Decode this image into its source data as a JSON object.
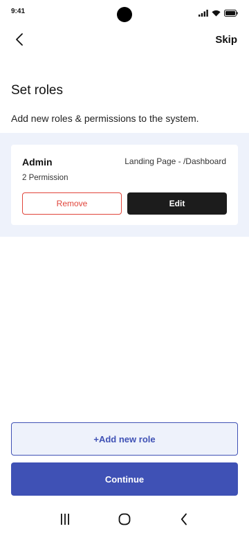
{
  "status_bar": {
    "time": "9:41",
    "icons": [
      "signal-icon",
      "wifi-icon",
      "battery-icon"
    ]
  },
  "header": {
    "back_icon": "chevron-left-icon",
    "skip_label": "Skip"
  },
  "page": {
    "title": "Set roles",
    "subtitle": "Add new roles & permissions to the system."
  },
  "roles": [
    {
      "name": "Admin",
      "landing_page": "Landing Page - /Dashboard",
      "permissions": "2 Permission",
      "remove_label": "Remove",
      "edit_label": "Edit"
    }
  ],
  "actions": {
    "add_role_label": "+Add new role",
    "continue_label": "Continue"
  },
  "nav": {
    "items": [
      "recent-apps-icon",
      "home-icon",
      "back-icon"
    ]
  },
  "colors": {
    "primary": "#3f51b5",
    "panel_bg": "#eef2fb",
    "danger": "#e0443a",
    "dark": "#1c1c1c"
  }
}
